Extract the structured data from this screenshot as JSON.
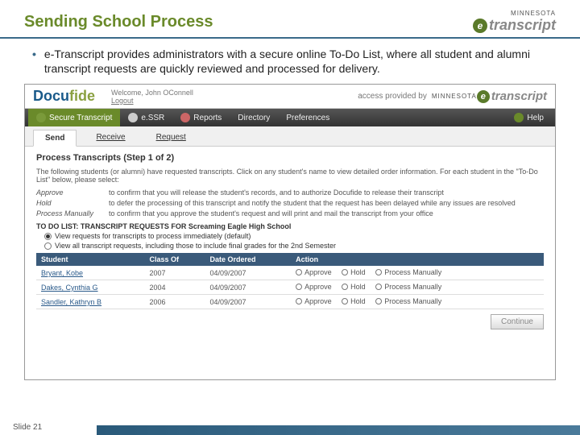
{
  "slide": {
    "title": "Sending School Process",
    "bullet": "e-Transcript provides administrators with a secure online To-Do List, where all student and alumni transcript requests are quickly reviewed and processed for delivery.",
    "footer": "Slide 21"
  },
  "brand": {
    "mn": "MINNESOTA",
    "e": "e",
    "transcript": "transcript"
  },
  "app": {
    "logo_a": "Docu",
    "logo_b": "fide",
    "welcome": "Welcome, John OConnell",
    "logout": "Logout",
    "access_label": "access provided by"
  },
  "nav": {
    "items": [
      {
        "label": "Secure Transcript"
      },
      {
        "label": "e.SSR"
      },
      {
        "label": "Reports"
      },
      {
        "label": "Directory"
      },
      {
        "label": "Preferences"
      }
    ],
    "help": "Help"
  },
  "subtabs": {
    "items": [
      {
        "label": "Send"
      },
      {
        "label": "Receive"
      },
      {
        "label": "Request"
      }
    ]
  },
  "process": {
    "title": "Process Transcripts (Step 1 of 2)",
    "intro": "The following students (or alumni) have requested transcripts. Click on any student's name to view detailed order information. For each student in the \"To-Do List\" below, please select:",
    "defs": [
      {
        "term": "Approve",
        "desc": "to confirm that you will release the student's records, and to authorize Docufide to release their transcript"
      },
      {
        "term": "Hold",
        "desc": "to defer the processing of this transcript and notify the student that the request has been delayed while any issues are resolved"
      },
      {
        "term": "Process Manually",
        "desc": "to confirm that you approve the student's request and will print and mail the transcript from your office"
      }
    ],
    "todo_header": "TO DO LIST: TRANSCRIPT REQUESTS FOR Screaming Eagle High School",
    "view_opts": [
      {
        "label": "View requests for transcripts to process immediately (default)",
        "checked": true
      },
      {
        "label": "View all transcript requests, including those to include final grades for the 2nd Semester",
        "checked": false
      }
    ],
    "columns": {
      "student": "Student",
      "classof": "Class Of",
      "date": "Date Ordered",
      "action": "Action"
    },
    "rows": [
      {
        "student": "Bryant, Kobe",
        "classof": "2007",
        "date": "04/09/2007"
      },
      {
        "student": "Dakes, Cynthia G",
        "classof": "2004",
        "date": "04/09/2007"
      },
      {
        "student": "Sandler, Kathryn B",
        "classof": "2006",
        "date": "04/09/2007"
      }
    ],
    "actions": {
      "approve": "Approve",
      "hold": "Hold",
      "manual": "Process Manually"
    },
    "continue": "Continue"
  }
}
